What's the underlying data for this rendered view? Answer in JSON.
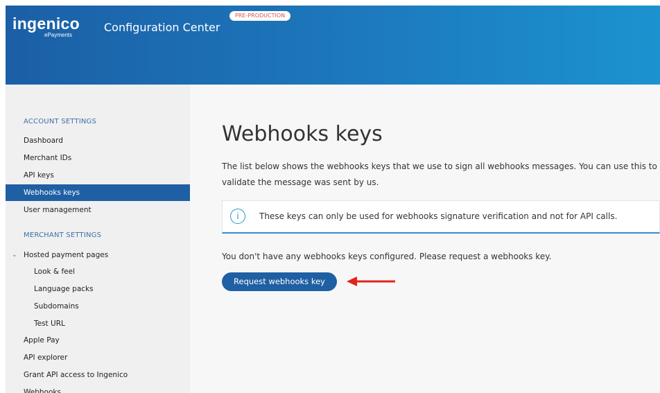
{
  "header": {
    "logo_main": "ingenico",
    "logo_sub": "ePayments",
    "app_title": "Configuration Center",
    "env_badge": "PRE-PRODUCTION"
  },
  "sidebar": {
    "account_section": "ACCOUNT SETTINGS",
    "account_items": [
      {
        "label": "Dashboard"
      },
      {
        "label": "Merchant IDs"
      },
      {
        "label": "API keys"
      },
      {
        "label": "Webhooks keys",
        "active": true
      },
      {
        "label": "User management"
      }
    ],
    "merchant_section": "MERCHANT SETTINGS",
    "merchant_items": [
      {
        "label": "Hosted payment pages",
        "expanded": true
      },
      {
        "label": "Look & feel"
      },
      {
        "label": "Language packs"
      },
      {
        "label": "Subdomains"
      },
      {
        "label": "Test URL"
      },
      {
        "label": "Apple Pay"
      },
      {
        "label": "API explorer"
      },
      {
        "label": "Grant API access to Ingenico"
      },
      {
        "label": "Webhooks"
      }
    ]
  },
  "main": {
    "title": "Webhooks keys",
    "intro": "The list below shows the webhooks keys that we use to sign all webhooks messages. You can use this to validate the message was sent by us.",
    "info_icon": "info-icon",
    "info_text": "These keys can only be used for webhooks signature verification and not for API calls.",
    "empty_message": "You don't have any webhooks keys configured. Please request a webhooks key.",
    "request_button": "Request webhooks key"
  },
  "colors": {
    "header_start": "#1b5fa6",
    "header_end": "#1b93cf",
    "primary": "#1f5fa3",
    "accent": "#2a8fcd",
    "badge_text": "#d9534f",
    "annotation_arrow": "#e1251b"
  }
}
